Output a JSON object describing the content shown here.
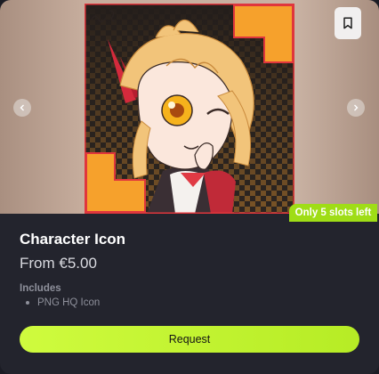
{
  "colors": {
    "card_bg": "#23242d",
    "accent_green": "#9fdd16",
    "button_gradient_start": "#cffb3e",
    "button_gradient_end": "#b6ec25",
    "artwork_frame": "#e0363c",
    "artwork_corner": "#f6a12c"
  },
  "gallery": {
    "artwork_alt": "",
    "icons": {
      "prev": "chevron-left-icon",
      "next": "chevron-right-icon",
      "bookmark": "bookmark-icon"
    },
    "badge": "Only 5 slots left"
  },
  "product": {
    "title": "Character Icon",
    "price": "From €5.00",
    "includes_label": "Includes",
    "includes": [
      "PNG HQ Icon"
    ]
  },
  "actions": {
    "request_label": "Request"
  }
}
